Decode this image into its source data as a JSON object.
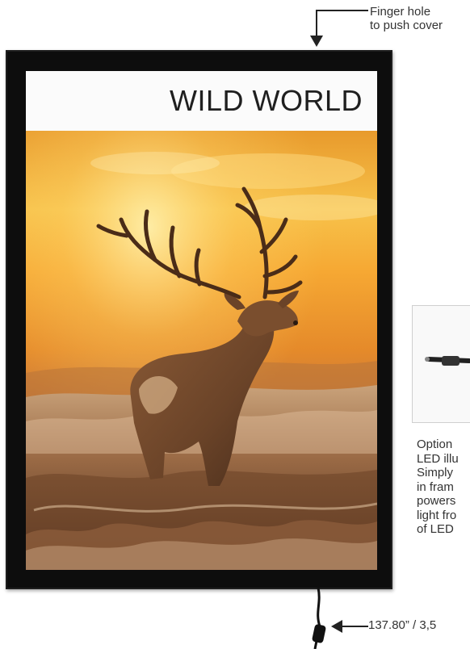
{
  "callout_top": {
    "line1": "Finger hole",
    "line2": "to push cover"
  },
  "poster": {
    "title": "WILD WORLD"
  },
  "option_text": {
    "lines": [
      "Option",
      "LED illu",
      "Simply",
      "in fram",
      "powers",
      "light fro",
      "of LED"
    ]
  },
  "cable_length_label": "137.80” / 3,5",
  "colors": {
    "frame": "#0d0d0d",
    "sky_glow": "#f5a623",
    "text": "#333333"
  },
  "icons": {
    "arrow_down": "arrow-down-icon",
    "arrow_left": "arrow-left-icon",
    "power_cable": "power-cable-icon"
  }
}
